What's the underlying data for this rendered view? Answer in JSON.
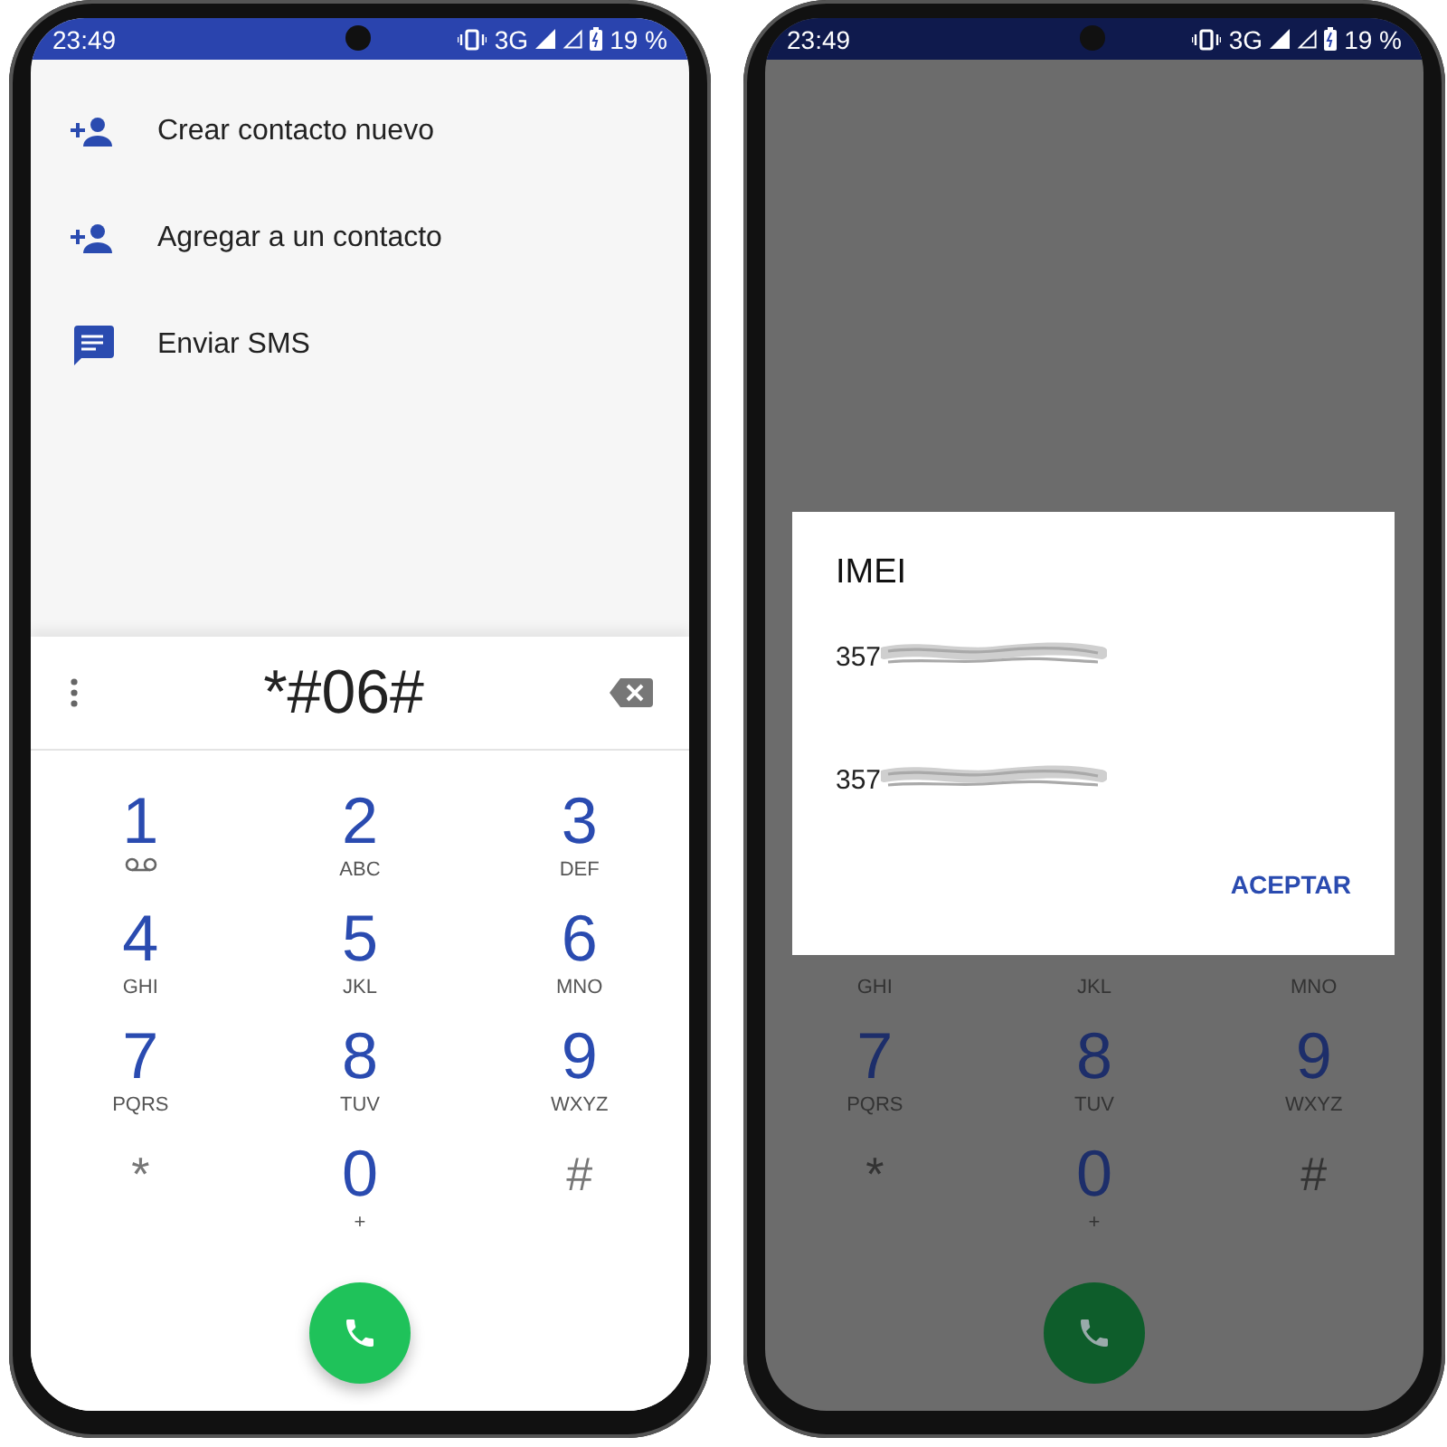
{
  "phones": [
    {
      "dimmed": false,
      "status_bar": {
        "time": "23:49",
        "network": "3G",
        "battery": "19 %"
      },
      "actions": [
        {
          "kind": "add_person",
          "label": "Crear contacto nuevo"
        },
        {
          "kind": "add_person",
          "label": "Agregar a un contacto"
        },
        {
          "kind": "message",
          "label": "Enviar SMS"
        }
      ],
      "dialer": {
        "number": "*#06#"
      },
      "keypad": [
        [
          {
            "kind": "voicemail",
            "digit": "1"
          },
          {
            "kind": "number",
            "digit": "2",
            "letters": "ABC"
          },
          {
            "kind": "number",
            "digit": "3",
            "letters": "DEF"
          }
        ],
        [
          {
            "kind": "number",
            "digit": "4",
            "letters": "GHI"
          },
          {
            "kind": "number",
            "digit": "5",
            "letters": "JKL"
          },
          {
            "kind": "number",
            "digit": "6",
            "letters": "MNO"
          }
        ],
        [
          {
            "kind": "number",
            "digit": "7",
            "letters": "PQRS"
          },
          {
            "kind": "number",
            "digit": "8",
            "letters": "TUV"
          },
          {
            "kind": "number",
            "digit": "9",
            "letters": "WXYZ"
          }
        ],
        [
          {
            "kind": "symbol",
            "digit": "*"
          },
          {
            "kind": "number",
            "digit": "0",
            "letters": "+"
          },
          {
            "kind": "symbol",
            "digit": "#"
          }
        ]
      ]
    },
    {
      "dimmed": true,
      "status_bar": {
        "time": "23:49",
        "network": "3G",
        "battery": "19 %"
      },
      "keypad": [
        [
          {
            "kind": "number",
            "letters": "GHI"
          },
          {
            "kind": "number",
            "letters": "JKL"
          },
          {
            "kind": "number",
            "letters": "MNO"
          }
        ],
        [
          {
            "kind": "number",
            "digit": "7",
            "letters": "PQRS"
          },
          {
            "kind": "number",
            "digit": "8",
            "letters": "TUV"
          },
          {
            "kind": "number",
            "digit": "9",
            "letters": "WXYZ"
          }
        ],
        [
          {
            "kind": "symbol",
            "digit": "*"
          },
          {
            "kind": "number",
            "digit": "0",
            "letters": "+"
          },
          {
            "kind": "symbol",
            "digit": "#"
          }
        ]
      ],
      "dialog": {
        "title": "IMEI",
        "lines": [
          "357",
          "357"
        ],
        "button": "ACEPTAR"
      }
    }
  ]
}
